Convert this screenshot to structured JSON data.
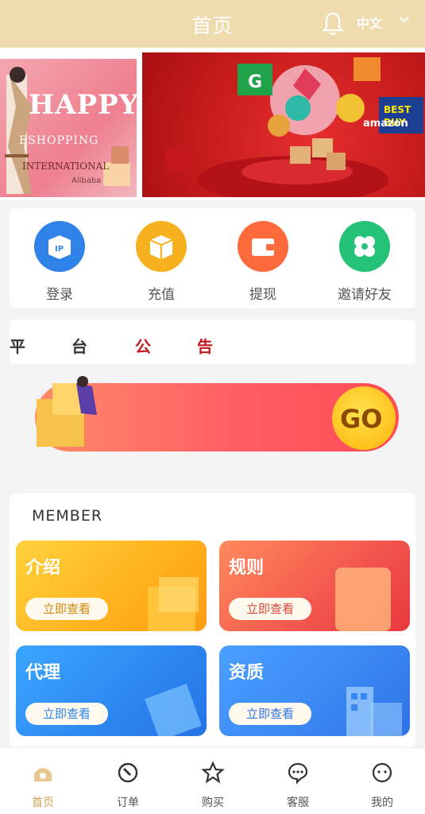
{
  "header": {
    "title": "首页",
    "language": "中文"
  },
  "banner": {
    "left": {
      "headline": "HAPPY",
      "sub": "ESHOPPING",
      "intl": "INTERNATIONAL",
      "brand": "Alibaba"
    },
    "right": {
      "brand_text": "amazon",
      "logos": [
        "G",
        "BEST BUY"
      ]
    }
  },
  "quick": [
    {
      "label": "登录",
      "icon": "ip-box-icon",
      "color": "#2f83e8"
    },
    {
      "label": "充值",
      "icon": "recharge-box-icon",
      "color": "#f7b01e"
    },
    {
      "label": "提现",
      "icon": "wallet-icon",
      "color": "#ff6a3d"
    },
    {
      "label": "邀请好友",
      "icon": "invite-icon",
      "color": "#23c277"
    }
  ],
  "notice": {
    "chars": [
      "平",
      "台",
      "公",
      "告"
    ]
  },
  "promo": {
    "go": "GO"
  },
  "member": {
    "title": "MEMBER",
    "cards": [
      {
        "title": "介绍",
        "button": "立即查看"
      },
      {
        "title": "规则",
        "button": "立即查看"
      },
      {
        "title": "代理",
        "button": "立即查看"
      },
      {
        "title": "资质",
        "button": "立即查看"
      }
    ]
  },
  "tabbar": [
    {
      "label": "首页",
      "icon": "home-icon"
    },
    {
      "label": "订单",
      "icon": "order-icon"
    },
    {
      "label": "购买",
      "icon": "star-icon"
    },
    {
      "label": "客服",
      "icon": "chat-icon"
    },
    {
      "label": "我的",
      "icon": "profile-icon"
    }
  ]
}
